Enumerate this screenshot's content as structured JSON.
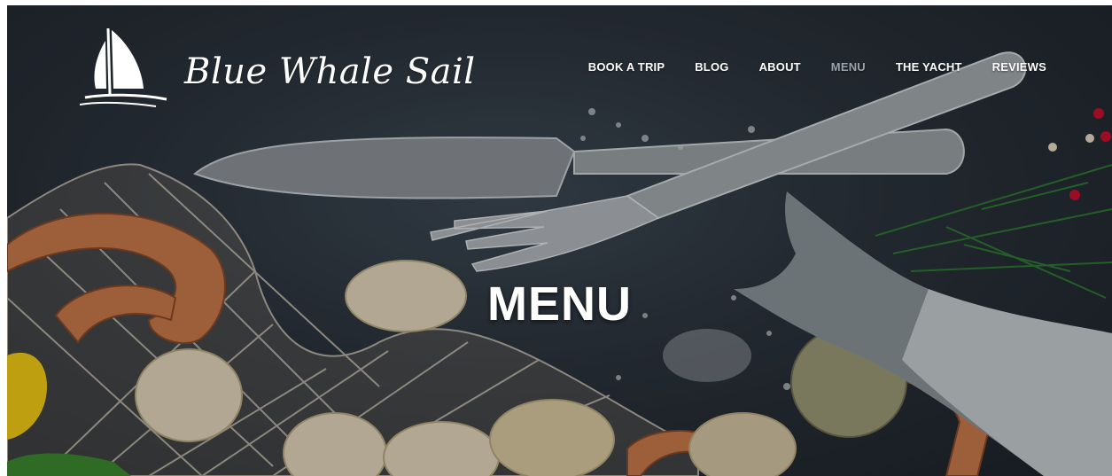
{
  "brand": {
    "name": "Blue Whale Sail",
    "logo_icon": "sailboat-icon"
  },
  "nav": {
    "items": [
      {
        "label": "BOOK A TRIP",
        "active": false
      },
      {
        "label": "BLOG",
        "active": false
      },
      {
        "label": "ABOUT",
        "active": false
      },
      {
        "label": "MENU",
        "active": true
      },
      {
        "label": "THE YACHT",
        "active": false
      },
      {
        "label": "REVIEWS",
        "active": false
      }
    ]
  },
  "hero": {
    "title": "MENU"
  },
  "colors": {
    "nav_text": "#ffffff",
    "nav_active": "#9aa3ac",
    "background": "#2b333c"
  }
}
